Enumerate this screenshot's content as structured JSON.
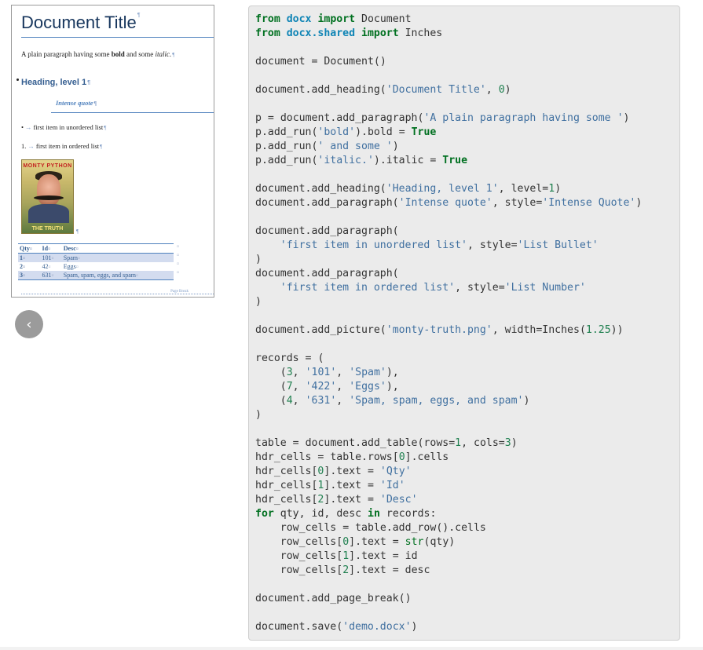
{
  "preview": {
    "title": "Document Title",
    "pilcrow": "¶",
    "paragraph": {
      "prefix": "A plain paragraph having some ",
      "bold": "bold",
      "middle": " and some ",
      "italic": "italic."
    },
    "heading1": "Heading, level 1",
    "quote": "Intense quote",
    "bullet_item": {
      "marker": "•",
      "tab": "→",
      "text": "first item in unordered list"
    },
    "numbered_item": {
      "marker": "1.",
      "tab": "→",
      "text": "first item in ordered list"
    },
    "image": {
      "top_text": "MONTY PYTHON",
      "bottom_text": "THE TRUTH"
    },
    "table": {
      "cell_mark": "¤",
      "headers": [
        "Qty",
        "Id",
        "Desc"
      ],
      "rows": [
        [
          "1",
          "101",
          "Spam"
        ],
        [
          "2",
          "42",
          "Eggs"
        ],
        [
          "3",
          "631",
          "Spam, spam, eggs, and spam"
        ]
      ]
    },
    "page_break_label": "Page Break"
  },
  "nav": {
    "prev_icon": "‹"
  },
  "code_lines": [
    "from docx import Document",
    "from docx.shared import Inches",
    "",
    "document = Document()",
    "",
    "document.add_heading('Document Title', 0)",
    "",
    "p = document.add_paragraph('A plain paragraph having some ')",
    "p.add_run('bold').bold = True",
    "p.add_run(' and some ')",
    "p.add_run('italic.').italic = True",
    "",
    "document.add_heading('Heading, level 1', level=1)",
    "document.add_paragraph('Intense quote', style='Intense Quote')",
    "",
    "document.add_paragraph(",
    "    'first item in unordered list', style='List Bullet'",
    ")",
    "document.add_paragraph(",
    "    'first item in ordered list', style='List Number'",
    ")",
    "",
    "document.add_picture('monty-truth.png', width=Inches(1.25))",
    "",
    "records = (",
    "    (3, '101', 'Spam'),",
    "    (7, '422', 'Eggs'),",
    "    (4, '631', 'Spam, spam, eggs, and spam')",
    ")",
    "",
    "table = document.add_table(rows=1, cols=3)",
    "hdr_cells = table.rows[0].cells",
    "hdr_cells[0].text = 'Qty'",
    "hdr_cells[1].text = 'Id'",
    "hdr_cells[2].text = 'Desc'",
    "for qty, id, desc in records:",
    "    row_cells = table.add_row().cells",
    "    row_cells[0].text = str(qty)",
    "    row_cells[1].text = id",
    "    row_cells[2].text = desc",
    "",
    "document.add_page_break()",
    "",
    "document.save('demo.docx')"
  ],
  "colors": {
    "heading": "#17365d",
    "accent": "#4f81bd",
    "code_bg": "#ebebeb",
    "keyword": "#007020",
    "string": "#4070a0",
    "number": "#208050",
    "module": "#0e84b5"
  }
}
